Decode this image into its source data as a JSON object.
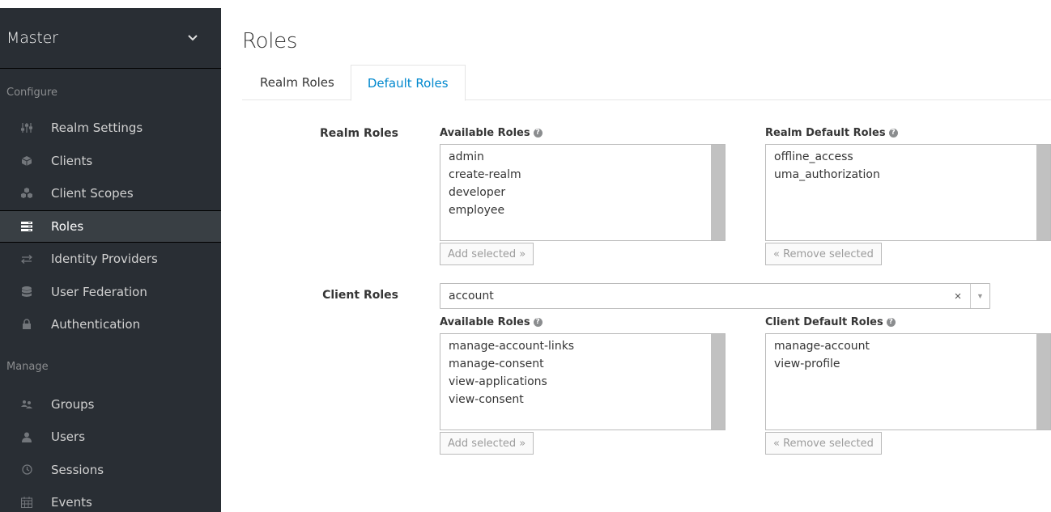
{
  "sidebar": {
    "realm": "Master",
    "configure_label": "Configure",
    "manage_label": "Manage",
    "configure_items": [
      {
        "label": "Realm Settings",
        "icon": "sliders-icon"
      },
      {
        "label": "Clients",
        "icon": "cube-icon"
      },
      {
        "label": "Client Scopes",
        "icon": "cubes-icon"
      },
      {
        "label": "Roles",
        "icon": "roles-icon",
        "active": true
      },
      {
        "label": "Identity Providers",
        "icon": "exchange-icon"
      },
      {
        "label": "User Federation",
        "icon": "database-icon"
      },
      {
        "label": "Authentication",
        "icon": "lock-icon"
      }
    ],
    "manage_items": [
      {
        "label": "Groups",
        "icon": "users-group-icon"
      },
      {
        "label": "Users",
        "icon": "user-icon"
      },
      {
        "label": "Sessions",
        "icon": "clock-icon"
      },
      {
        "label": "Events",
        "icon": "calendar-icon"
      }
    ]
  },
  "main": {
    "title": "Roles",
    "tabs": [
      {
        "label": "Realm Roles",
        "active": false
      },
      {
        "label": "Default Roles",
        "active": true
      }
    ],
    "realm_roles": {
      "row_label": "Realm Roles",
      "available_label": "Available Roles",
      "available": [
        "admin",
        "create-realm",
        "developer",
        "employee"
      ],
      "default_label": "Realm Default Roles",
      "defaults": [
        "offline_access",
        "uma_authorization"
      ],
      "add_button": "Add selected »",
      "remove_button": "« Remove selected"
    },
    "client_roles": {
      "row_label": "Client Roles",
      "client_value": "account",
      "available_label": "Available Roles",
      "available": [
        "manage-account-links",
        "manage-consent",
        "view-applications",
        "view-consent"
      ],
      "default_label": "Client Default Roles",
      "defaults": [
        "manage-account",
        "view-profile"
      ],
      "add_button": "Add selected »",
      "remove_button": "« Remove selected"
    }
  },
  "colors": {
    "sidebar_bg": "#292e34",
    "active_bg": "#393f44",
    "accent": "#0088ce"
  }
}
